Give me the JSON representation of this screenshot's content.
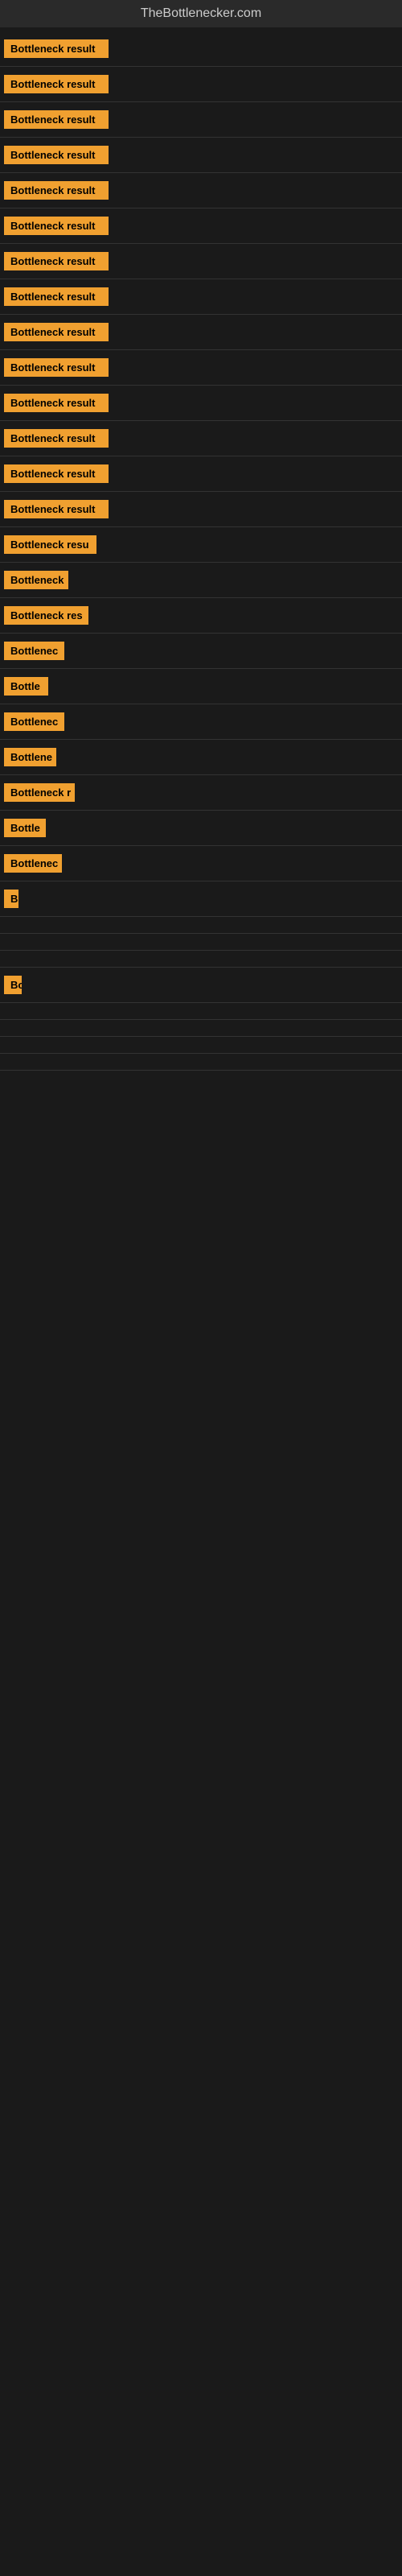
{
  "site_title": "TheBottlenecker.com",
  "items": [
    {
      "label": "Bottleneck result",
      "width": 130
    },
    {
      "label": "Bottleneck result",
      "width": 130
    },
    {
      "label": "Bottleneck result",
      "width": 130
    },
    {
      "label": "Bottleneck result",
      "width": 130
    },
    {
      "label": "Bottleneck result",
      "width": 130
    },
    {
      "label": "Bottleneck result",
      "width": 130
    },
    {
      "label": "Bottleneck result",
      "width": 130
    },
    {
      "label": "Bottleneck result",
      "width": 130
    },
    {
      "label": "Bottleneck result",
      "width": 130
    },
    {
      "label": "Bottleneck result",
      "width": 130
    },
    {
      "label": "Bottleneck result",
      "width": 130
    },
    {
      "label": "Bottleneck result",
      "width": 130
    },
    {
      "label": "Bottleneck result",
      "width": 130
    },
    {
      "label": "Bottleneck result",
      "width": 130
    },
    {
      "label": "Bottleneck resu",
      "width": 115
    },
    {
      "label": "Bottleneck",
      "width": 80
    },
    {
      "label": "Bottleneck res",
      "width": 105
    },
    {
      "label": "Bottlenec",
      "width": 75
    },
    {
      "label": "Bottle",
      "width": 55
    },
    {
      "label": "Bottlenec",
      "width": 75
    },
    {
      "label": "Bottlene",
      "width": 65
    },
    {
      "label": "Bottleneck r",
      "width": 88
    },
    {
      "label": "Bottle",
      "width": 52
    },
    {
      "label": "Bottlenec",
      "width": 72
    },
    {
      "label": "B",
      "width": 18
    },
    {
      "label": "",
      "width": 0
    },
    {
      "label": "",
      "width": 0
    },
    {
      "label": "",
      "width": 0
    },
    {
      "label": "Bo",
      "width": 22
    },
    {
      "label": "",
      "width": 0
    },
    {
      "label": "",
      "width": 0
    },
    {
      "label": "",
      "width": 0
    },
    {
      "label": "",
      "width": 0
    }
  ]
}
